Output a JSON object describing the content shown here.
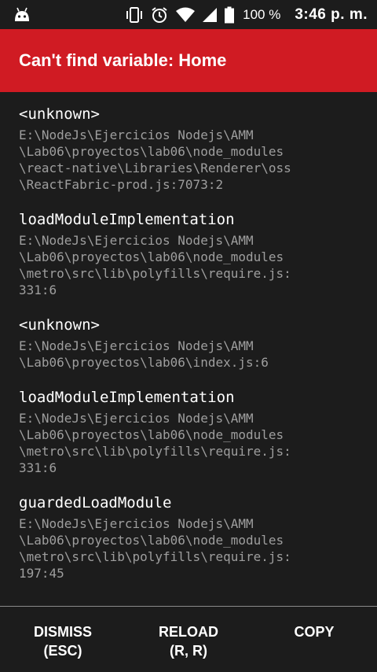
{
  "status_bar": {
    "left_icon": "android-debug-icon",
    "icons": [
      "vibrate-icon",
      "alarm-icon",
      "wifi-icon",
      "signal-icon",
      "battery-icon"
    ],
    "battery": "100 %",
    "time": "3:46 p. m."
  },
  "error": {
    "title": "Can't find variable: Home",
    "header_color": "#d01b23"
  },
  "stack": [
    {
      "method": "<unknown>",
      "file": "E:\\NodeJs\\Ejercicios Nodejs\\AMM\n\\Lab06\\proyectos\\lab06\\node_modules\n\\react-native\\Libraries\\Renderer\\oss\n\\ReactFabric-prod.js:7073:2"
    },
    {
      "method": "loadModuleImplementation",
      "file": "E:\\NodeJs\\Ejercicios Nodejs\\AMM\n\\Lab06\\proyectos\\lab06\\node_modules\n\\metro\\src\\lib\\polyfills\\require.js:\n331:6"
    },
    {
      "method": "<unknown>",
      "file": "E:\\NodeJs\\Ejercicios Nodejs\\AMM\n\\Lab06\\proyectos\\lab06\\index.js:6"
    },
    {
      "method": "loadModuleImplementation",
      "file": "E:\\NodeJs\\Ejercicios Nodejs\\AMM\n\\Lab06\\proyectos\\lab06\\node_modules\n\\metro\\src\\lib\\polyfills\\require.js:\n331:6"
    },
    {
      "method": "guardedLoadModule",
      "file": "E:\\NodeJs\\Ejercicios Nodejs\\AMM\n\\Lab06\\proyectos\\lab06\\node_modules\n\\metro\\src\\lib\\polyfills\\require.js:\n197:45"
    }
  ],
  "footer": {
    "dismiss": "DISMISS\n(ESC)",
    "reload": "RELOAD\n(R, R)",
    "copy": "COPY"
  }
}
